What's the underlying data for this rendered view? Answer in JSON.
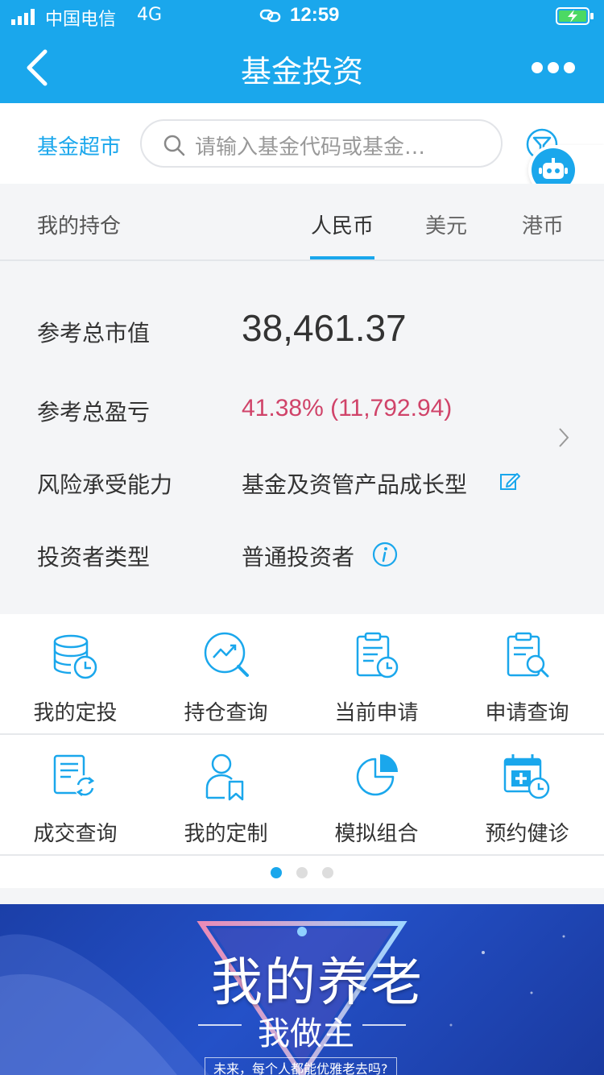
{
  "status": {
    "carrier": "中国电信",
    "network": "4G",
    "time": "12:59"
  },
  "nav": {
    "title": "基金投资"
  },
  "search": {
    "market_label": "基金超市",
    "placeholder": "请输入基金代码或基金…"
  },
  "holdings": {
    "label": "我的持仓",
    "tabs": [
      "人民币",
      "美元",
      "港币"
    ],
    "active_tab": "人民币"
  },
  "summary": {
    "total_value_label": "参考总市值",
    "total_value": "38,461.37",
    "total_pnl_label": "参考总盈亏",
    "total_pnl": "41.38% (11,792.94)",
    "risk_label": "风险承受能力",
    "risk_value": "基金及资管产品成长型",
    "investor_type_label": "投资者类型",
    "investor_type_value": "普通投资者"
  },
  "menu": [
    {
      "label": "我的定投",
      "icon": "database-clock-icon"
    },
    {
      "label": "持仓查询",
      "icon": "trend-search-icon"
    },
    {
      "label": "当前申请",
      "icon": "clipboard-clock-icon"
    },
    {
      "label": "申请查询",
      "icon": "clipboard-search-icon"
    },
    {
      "label": "成交查询",
      "icon": "document-refresh-icon"
    },
    {
      "label": "我的定制",
      "icon": "user-bookmark-icon"
    },
    {
      "label": "模拟组合",
      "icon": "pie-chart-icon"
    },
    {
      "label": "预约健诊",
      "icon": "calendar-medical-icon"
    }
  ],
  "pager": {
    "pages": 3,
    "active": 1
  },
  "banner": {
    "title": "我的养老",
    "subtitle": "我做主",
    "caption": "未来，每个人都能优雅老去吗?"
  },
  "colors": {
    "primary": "#1aa7ec",
    "loss_gain": "#d04369",
    "background": "#f4f5f7"
  }
}
